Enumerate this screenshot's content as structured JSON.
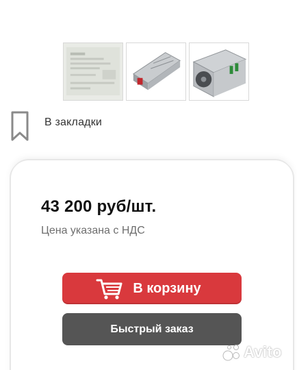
{
  "gallery": {
    "thumbnails": [
      {
        "icon": "product-label-photo"
      },
      {
        "icon": "power-supply-side-photo"
      },
      {
        "icon": "power-supply-fan-photo"
      }
    ]
  },
  "bookmark": {
    "label": "В закладки",
    "icon": "bookmark-icon"
  },
  "offer": {
    "price": "43 200 руб/шт.",
    "price_note": "Цена указана с НДС"
  },
  "actions": {
    "cart_label": "В корзину",
    "cart_icon": "cart-icon",
    "quick_order_label": "Быстрый заказ"
  },
  "watermark": {
    "text": "Avito"
  },
  "colors": {
    "cart_button": "#d9393d",
    "quick_button": "#555555",
    "price_note": "#6e6e6e"
  }
}
